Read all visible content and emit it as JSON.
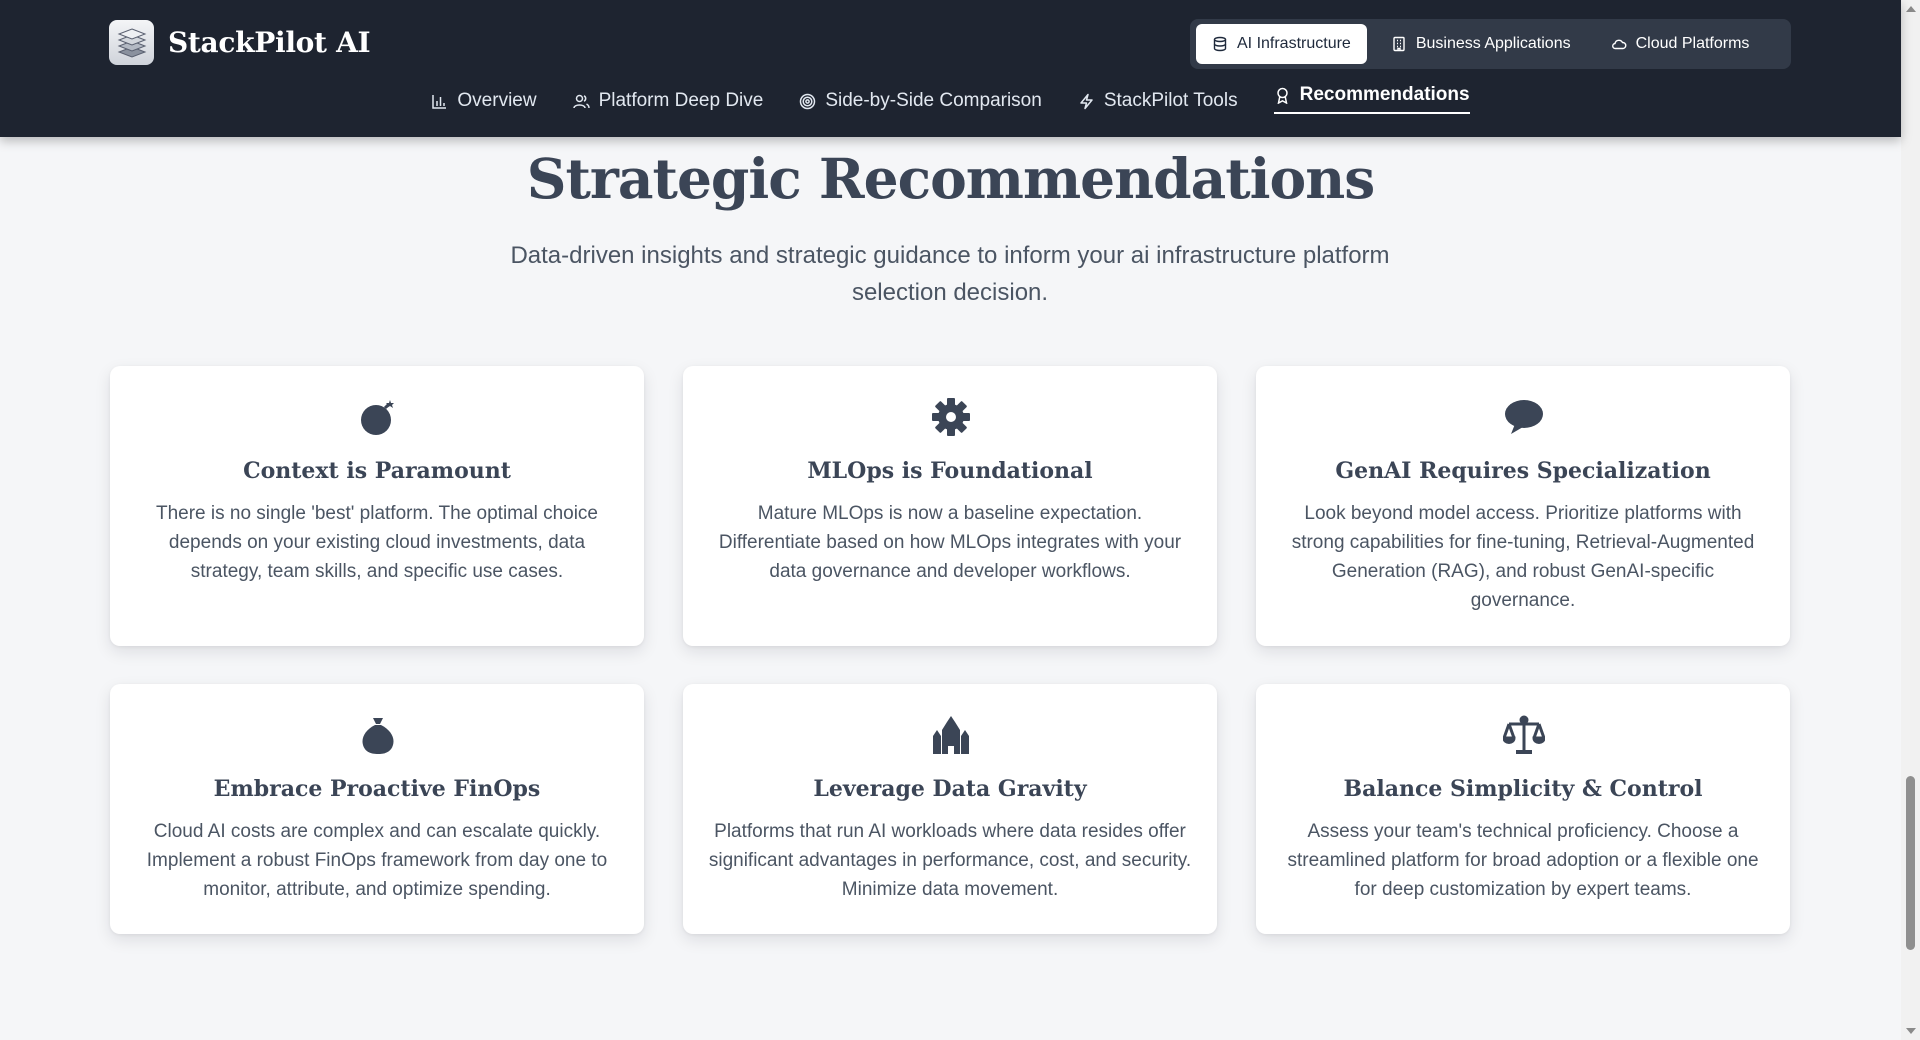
{
  "header": {
    "brand": "StackPilot AI",
    "segments": [
      {
        "label": "AI Infrastructure",
        "icon": "database-icon",
        "active": true
      },
      {
        "label": "Business Applications",
        "icon": "building-icon",
        "active": false
      },
      {
        "label": "Cloud Platforms",
        "icon": "cloud-icon",
        "active": false
      }
    ],
    "tabs": [
      {
        "label": "Overview",
        "icon": "bar-chart-icon",
        "active": false
      },
      {
        "label": "Platform Deep Dive",
        "icon": "users-icon",
        "active": false
      },
      {
        "label": "Side-by-Side Comparison",
        "icon": "target-icon",
        "active": false
      },
      {
        "label": "StackPilot Tools",
        "icon": "lightning-icon",
        "active": false
      },
      {
        "label": "Recommendations",
        "icon": "award-icon",
        "active": true
      }
    ]
  },
  "main": {
    "title": "Strategic Recommendations",
    "subtitle": "Data-driven insights and strategic guidance to inform your ai infrastructure platform selection decision."
  },
  "cards": [
    {
      "icon": "bomb-icon",
      "title": "Context is Paramount",
      "body": "There is no single 'best' platform. The optimal choice depends on your existing cloud investments, data strategy, team skills, and specific use cases."
    },
    {
      "icon": "gear-icon",
      "title": "MLOps is Foundational",
      "body": "Mature MLOps is now a baseline expectation. Differentiate based on how MLOps integrates with your data governance and developer workflows."
    },
    {
      "icon": "speech-bubble-icon",
      "title": "GenAI Requires Specialization",
      "body": "Look beyond model access. Prioritize platforms with strong capabilities for fine-tuning, Retrieval-Augmented Generation (RAG), and robust GenAI-specific governance."
    },
    {
      "icon": "money-bag-icon",
      "title": "Embrace Proactive FinOps",
      "body": "Cloud AI costs are complex and can escalate quickly. Implement a robust FinOps framework from day one to monitor, attribute, and optimize spending."
    },
    {
      "icon": "castle-icon",
      "title": "Leverage Data Gravity",
      "body": "Platforms that run AI workloads where data resides offer significant advantages in performance, cost, and security. Minimize data movement."
    },
    {
      "icon": "scales-icon",
      "title": "Balance Simplicity & Control",
      "body": "Assess your team's technical proficiency. Choose a streamlined platform for broad adoption or a flexible one for deep customization by expert teams."
    }
  ]
}
